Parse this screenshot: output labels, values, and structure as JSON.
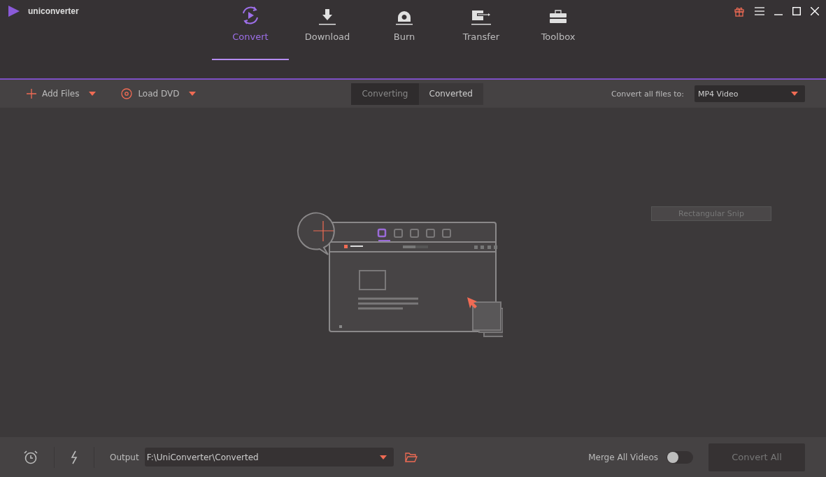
{
  "window": {
    "title": "uniconverter"
  },
  "nav": [
    {
      "kind": "convert",
      "label": "Convert",
      "selected": true
    },
    {
      "kind": "download",
      "label": "Download",
      "selected": false
    },
    {
      "kind": "burn",
      "label": "Burn",
      "selected": false
    },
    {
      "kind": "transfer",
      "label": "Transfer",
      "selected": false
    },
    {
      "kind": "toolbox",
      "label": "Toolbox",
      "selected": false
    }
  ],
  "toolbar": {
    "add_files": "Add Files",
    "load_dvd": "Load DVD",
    "tabs": [
      {
        "label": "Converting",
        "selected": false
      },
      {
        "label": "Converted",
        "selected": true
      }
    ],
    "convert_label": "Convert all files to:",
    "format": "MP4 Video"
  },
  "snip_tooltip": "Rectangular Snip",
  "bottom": {
    "output_label": "Output",
    "output_path": "F:\\UniConverter\\Converted",
    "merge_label": "Merge All Videos",
    "merge_on": false,
    "convert_all": "Convert All",
    "convert_all_disabled": true
  }
}
